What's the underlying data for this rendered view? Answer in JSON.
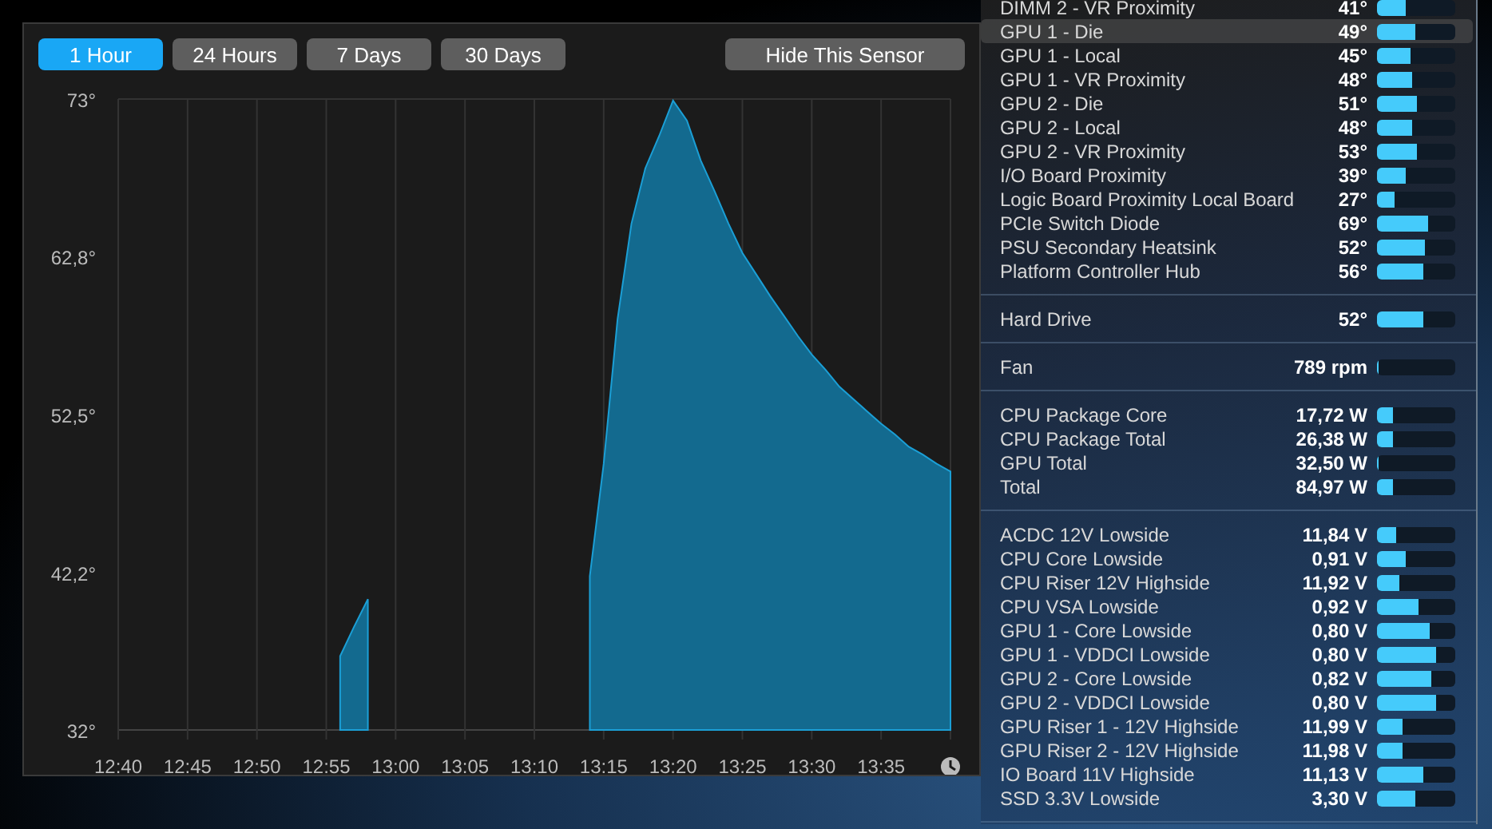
{
  "time_buttons": [
    {
      "label": "1 Hour",
      "selected": true
    },
    {
      "label": "24 Hours",
      "selected": false
    },
    {
      "label": "7 Days",
      "selected": false
    },
    {
      "label": "30 Days",
      "selected": false
    }
  ],
  "hide_button": "Hide This Sensor",
  "chart_data": {
    "type": "area",
    "ylim": [
      32,
      73
    ],
    "grid": true,
    "categories": [
      "12:40",
      null,
      null,
      null,
      null,
      "12:45",
      null,
      null,
      null,
      null,
      "12:50",
      null,
      null,
      null,
      null,
      "12:55",
      null,
      null,
      null,
      null,
      "13:00",
      null,
      null,
      null,
      null,
      "13:05",
      null,
      null,
      null,
      null,
      "13:10",
      null,
      null,
      null,
      null,
      "13:15",
      null,
      null,
      null,
      null,
      "13:20",
      null,
      null,
      null,
      null,
      "13:25",
      null,
      null,
      null,
      null,
      "13:30",
      null,
      null,
      null,
      null,
      "13:35",
      null,
      null,
      null,
      null,
      null
    ],
    "yticks": [
      {
        "value": 32,
        "label": "32°"
      },
      {
        "value": 42.2,
        "label": "42,2°"
      },
      {
        "value": 52.5,
        "label": "52,5°"
      },
      {
        "value": 62.8,
        "label": "62,8°"
      },
      {
        "value": 73,
        "label": "73°"
      }
    ],
    "series": [
      {
        "color": "#136a8f",
        "values": [
          null,
          null,
          null,
          null,
          null,
          null,
          null,
          null,
          null,
          null,
          null,
          null,
          null,
          null,
          null,
          null,
          36.8,
          38.7,
          40.5,
          null,
          null,
          null,
          null,
          null,
          null,
          null,
          null,
          null,
          null,
          null,
          null,
          null,
          null,
          null,
          42,
          49.3,
          58.7,
          64.9,
          68.5,
          70.6,
          72.9,
          71.6,
          69,
          67,
          64.9,
          63,
          61.6,
          60.2,
          58.9,
          57.6,
          56.4,
          55.4,
          54.3,
          53.5,
          52.7,
          51.9,
          51.2,
          50.4,
          49.9,
          49.3,
          48.8
        ]
      }
    ]
  },
  "sensor_sections": [
    {
      "rows": [
        {
          "name": "DIMM 2 - VR Proximity",
          "value": "41°",
          "level": 0.37,
          "selected": false
        },
        {
          "name": "GPU 1 - Die",
          "value": "49°",
          "level": 0.48,
          "selected": true
        },
        {
          "name": "GPU 1 - Local",
          "value": "45°",
          "level": 0.42,
          "selected": false
        },
        {
          "name": "GPU 1 - VR Proximity",
          "value": "48°",
          "level": 0.44,
          "selected": false
        },
        {
          "name": "GPU 2 - Die",
          "value": "51°",
          "level": 0.5,
          "selected": false
        },
        {
          "name": "GPU 2 - Local",
          "value": "48°",
          "level": 0.44,
          "selected": false
        },
        {
          "name": "GPU 2 - VR Proximity",
          "value": "53°",
          "level": 0.5,
          "selected": false
        },
        {
          "name": "I/O Board Proximity",
          "value": "39°",
          "level": 0.36,
          "selected": false
        },
        {
          "name": "Logic Board Proximity Local Board",
          "value": "27°",
          "level": 0.22,
          "selected": false
        },
        {
          "name": "PCIe Switch Diode",
          "value": "69°",
          "level": 0.66,
          "selected": false
        },
        {
          "name": "PSU Secondary Heatsink",
          "value": "52°",
          "level": 0.62,
          "selected": false
        },
        {
          "name": "Platform Controller Hub",
          "value": "56°",
          "level": 0.6,
          "selected": false
        }
      ]
    },
    {
      "rows": [
        {
          "name": "Hard Drive",
          "value": "52°",
          "level": 0.6,
          "selected": false
        }
      ]
    },
    {
      "rows": [
        {
          "name": "Fan",
          "value": "789 rpm",
          "level": 0.02,
          "selected": false
        }
      ]
    },
    {
      "rows": [
        {
          "name": "CPU Package Core",
          "value": "17,72 W",
          "level": 0.2,
          "selected": false
        },
        {
          "name": "CPU Package Total",
          "value": "26,38 W",
          "level": 0.2,
          "selected": false
        },
        {
          "name": "GPU Total",
          "value": "32,50 W",
          "level": 0.03,
          "selected": false
        },
        {
          "name": "Total",
          "value": "84,97 W",
          "level": 0.2,
          "selected": false
        }
      ]
    },
    {
      "rows": [
        {
          "name": "ACDC 12V Lowside",
          "value": "11,84 V",
          "level": 0.25,
          "selected": false
        },
        {
          "name": "CPU Core Lowside",
          "value": "0,91 V",
          "level": 0.36,
          "selected": false
        },
        {
          "name": "CPU Riser 12V Highside",
          "value": "11,92 V",
          "level": 0.28,
          "selected": false
        },
        {
          "name": "CPU VSA Lowside",
          "value": "0,92 V",
          "level": 0.54,
          "selected": false
        },
        {
          "name": "GPU 1 - Core Lowside",
          "value": "0,80 V",
          "level": 0.68,
          "selected": false
        },
        {
          "name": "GPU 1 - VDDCI Lowside",
          "value": "0,80 V",
          "level": 0.76,
          "selected": false
        },
        {
          "name": "GPU 2 - Core Lowside",
          "value": "0,82 V",
          "level": 0.7,
          "selected": false
        },
        {
          "name": "GPU 2 - VDDCI Lowside",
          "value": "0,80 V",
          "level": 0.76,
          "selected": false
        },
        {
          "name": "GPU Riser 1 - 12V Highside",
          "value": "11,99 V",
          "level": 0.32,
          "selected": false
        },
        {
          "name": "GPU Riser 2 - 12V Highside",
          "value": "11,98 V",
          "level": 0.32,
          "selected": false
        },
        {
          "name": "IO Board 11V Highside",
          "value": "11,13 V",
          "level": 0.6,
          "selected": false
        },
        {
          "name": "SSD 3.3V Lowside",
          "value": "3,30 V",
          "level": 0.48,
          "selected": false
        }
      ]
    }
  ]
}
